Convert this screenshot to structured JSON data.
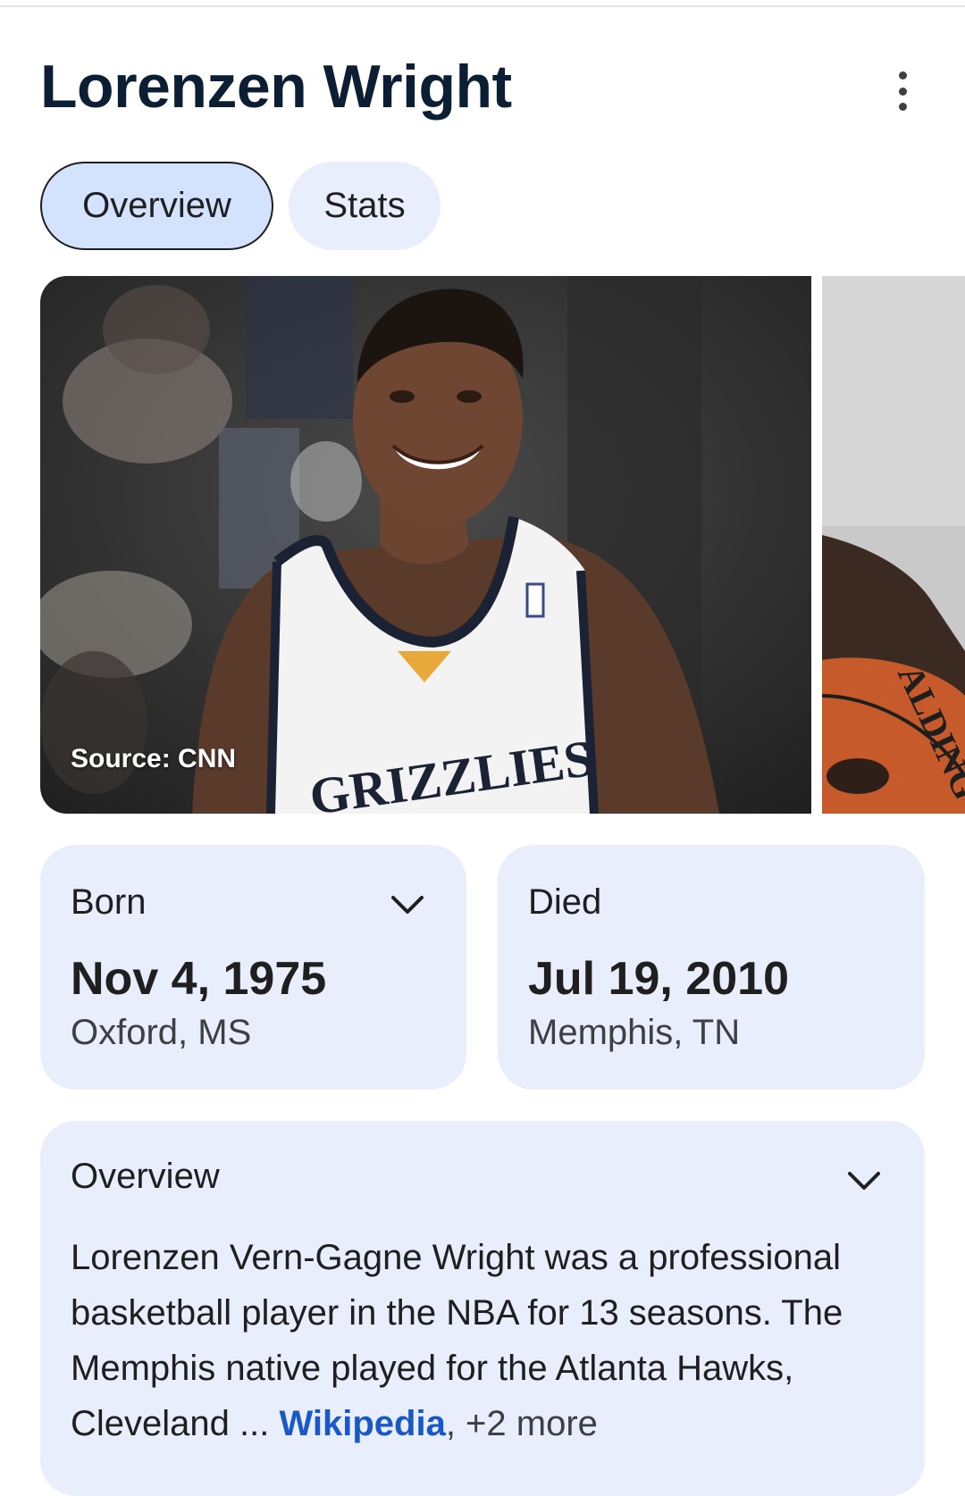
{
  "header": {
    "title": "Lorenzen Wright"
  },
  "tabs": [
    {
      "label": "Overview",
      "active": true
    },
    {
      "label": "Stats",
      "active": false
    }
  ],
  "gallery": {
    "source_caption": "Source: CNN",
    "jersey_text": "GRIZZLIES",
    "ball_text": "ALDING"
  },
  "facts": {
    "born": {
      "label": "Born",
      "date": "Nov 4, 1975",
      "place": "Oxford, MS"
    },
    "died": {
      "label": "Died",
      "date": "Jul 19, 2010",
      "place": "Memphis, TN"
    }
  },
  "overview": {
    "label": "Overview",
    "text": "Lorenzen Vern-Gagne Wright was a professional basketball player in the NBA for 13 seasons. The Memphis native played for the Atlanta Hawks, Cleveland",
    "ellipsis": " ... ",
    "source_link": "Wikipedia",
    "more_link": ", +2 more"
  },
  "colors": {
    "accent_chip": "#d3e3fd",
    "card_bg": "#e8eefc",
    "link": "#1a57c7",
    "title": "#0b1e33"
  }
}
